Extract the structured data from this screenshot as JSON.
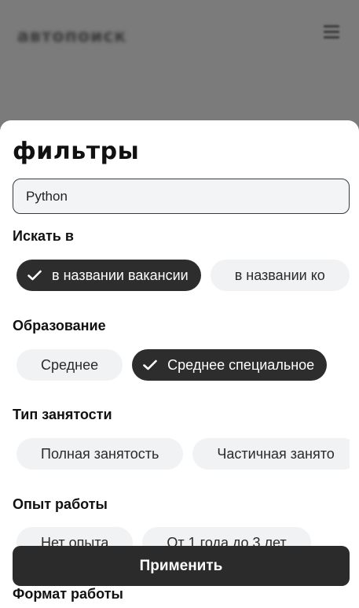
{
  "header": {
    "logo_text": "автопоиск",
    "menu_icon": "hamburger-icon"
  },
  "filters": {
    "title": "фильтры",
    "search_value": "Python",
    "sections": {
      "search_in": {
        "label": "Искать в",
        "options": [
          {
            "label": "в названии вакансии",
            "selected": true
          },
          {
            "label": "в названии ко",
            "selected": false
          }
        ]
      },
      "education": {
        "label": "Образование",
        "options": [
          {
            "label": "Среднее",
            "selected": false
          },
          {
            "label": "Среднее специальное",
            "selected": true
          }
        ]
      },
      "employment": {
        "label": "Тип занятости",
        "options": [
          {
            "label": "Полная занятость",
            "selected": false
          },
          {
            "label": "Частичная занято",
            "selected": false
          }
        ]
      },
      "experience": {
        "label": "Опыт работы",
        "options": [
          {
            "label": "Нет опыта",
            "selected": false
          },
          {
            "label": "От 1 года до 3 лет",
            "selected": false
          }
        ]
      },
      "work_format": {
        "label": "Формат работы"
      }
    },
    "apply_label": "Применить"
  },
  "colors": {
    "selected_chip": "#2d2d2d",
    "chip": "#f1f2f4",
    "apply_button": "#2b2b2b"
  }
}
